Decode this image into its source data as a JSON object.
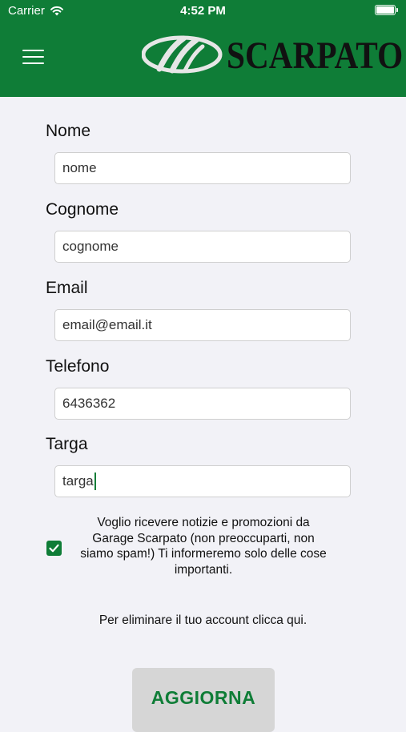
{
  "status_bar": {
    "carrier": "Carrier",
    "time": "4:52 PM"
  },
  "header": {
    "logo_text": "SCARPATO",
    "menu_icon": "hamburger-menu-icon",
    "brand_color": "#0f7d37"
  },
  "form": {
    "nome": {
      "label": "Nome",
      "value": "nome"
    },
    "cognome": {
      "label": "Cognome",
      "value": "cognome"
    },
    "email": {
      "label": "Email",
      "value": "email@email.it"
    },
    "telefono": {
      "label": "Telefono",
      "value": "6436362"
    },
    "targa": {
      "label": "Targa",
      "value": "targa"
    }
  },
  "consent": {
    "checked": true,
    "text": "Voglio ricevere notizie e promozioni da Garage Scarpato (non preoccuparti, non siamo spam!) Ti informeremo solo delle cose importanti."
  },
  "delete_account_text": "Per eliminare il tuo account clicca qui.",
  "update_button": "AGGIORNA"
}
